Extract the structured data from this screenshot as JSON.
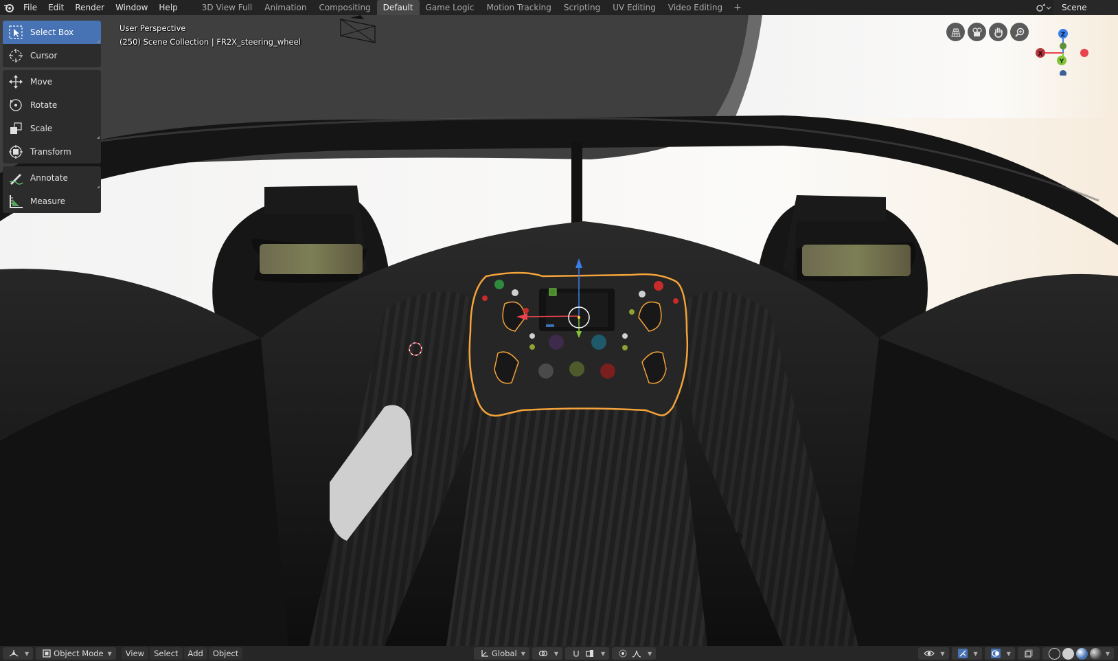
{
  "topbar": {
    "logo_icon": "blender-logo-icon",
    "menu": [
      "File",
      "Edit",
      "Render",
      "Window",
      "Help"
    ],
    "tabs": [
      "3D View Full",
      "Animation",
      "Compositing",
      "Default",
      "Game Logic",
      "Motion Tracking",
      "Scripting",
      "UV Editing",
      "Video Editing"
    ],
    "active_tab": "Default",
    "add_tab_label": "+",
    "scene_name": "Scene"
  },
  "toolbar": {
    "groups": [
      [
        {
          "label": "Select Box",
          "icon": "select-box-icon",
          "active": true
        },
        {
          "label": "Cursor",
          "icon": "cursor-icon"
        }
      ],
      [
        {
          "label": "Move",
          "icon": "move-icon"
        },
        {
          "label": "Rotate",
          "icon": "rotate-icon"
        },
        {
          "label": "Scale",
          "icon": "scale-icon"
        },
        {
          "label": "Transform",
          "icon": "transform-icon"
        }
      ],
      [
        {
          "label": "Annotate",
          "icon": "annotate-icon"
        },
        {
          "label": "Measure",
          "icon": "measure-icon"
        }
      ]
    ]
  },
  "viewport": {
    "perspective_label": "User Perspective",
    "collection_label": "(250) Scene Collection | FR2X_steering_wheel"
  },
  "gizmo": {
    "axes": [
      "X",
      "Y",
      "Z"
    ],
    "colors": {
      "x": "#e8434e",
      "y": "#82c43a",
      "z": "#3b7ee8",
      "neg_y": "#5f8f3b",
      "neg_z": "#3c5f9a"
    },
    "nav_icons": [
      "grid-view-icon",
      "camera-view-icon",
      "pan-hand-icon",
      "zoom-icon"
    ]
  },
  "bottombar": {
    "editor_type_icon": "editor-type-icon",
    "mode": "Object Mode",
    "menus": [
      "View",
      "Select",
      "Add",
      "Object"
    ],
    "orientation": "Global",
    "colors": {
      "selection_outline": "#f5a33a",
      "active_tool": "#4772b3"
    }
  }
}
